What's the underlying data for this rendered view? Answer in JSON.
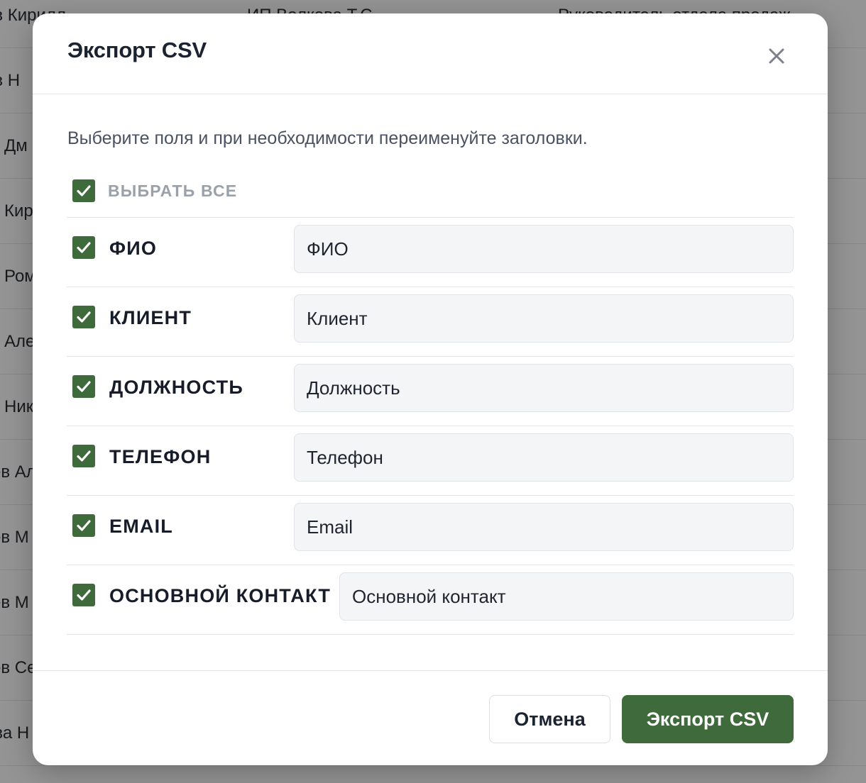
{
  "background": {
    "rows": [
      {
        "name": "ов Кирилл",
        "client": "ИП Волкова Т.С.",
        "role": "Руководитель отдела продаж"
      },
      {
        "name": "ов Н",
        "client": "",
        "role": ""
      },
      {
        "name": "Дм",
        "client": "",
        "role": ""
      },
      {
        "name": "Кир",
        "client": "",
        "role": ""
      },
      {
        "name": "Ром",
        "client": "",
        "role": ""
      },
      {
        "name": "Але",
        "client": "",
        "role": ""
      },
      {
        "name": "Ник",
        "client": "",
        "role": ""
      },
      {
        "name": "ев Ал",
        "client": "",
        "role": ""
      },
      {
        "name": "ев М",
        "client": "",
        "role": ""
      },
      {
        "name": "ев М",
        "client": "",
        "role": ""
      },
      {
        "name": "ев Се",
        "client": "",
        "role": ""
      },
      {
        "name": "ева Н",
        "client": "",
        "role": ""
      }
    ]
  },
  "modal": {
    "title": "Экспорт CSV",
    "close_icon": "close-icon",
    "subtitle": "Выберите поля и при необходимости переименуйте заголовки.",
    "select_all": {
      "label": "ВЫБРАТЬ ВСЕ",
      "checked": true
    },
    "fields": [
      {
        "label": "ФИО",
        "value": "ФИО",
        "checked": true
      },
      {
        "label": "КЛИЕНТ",
        "value": "Клиент",
        "checked": true
      },
      {
        "label": "ДОЛЖНОСТЬ",
        "value": "Должность",
        "checked": true
      },
      {
        "label": "ТЕЛЕФОН",
        "value": "Телефон",
        "checked": true
      },
      {
        "label": "EMAIL",
        "value": "Email",
        "checked": true
      },
      {
        "label": "ОСНОВНОЙ КОНТАКТ",
        "value": "Основной контакт",
        "checked": true
      }
    ],
    "cancel_label": "Отмена",
    "export_label": "Экспорт CSV"
  },
  "colors": {
    "accent": "#3f6b3c",
    "overlay": "rgba(0,0,0,0.42)"
  }
}
